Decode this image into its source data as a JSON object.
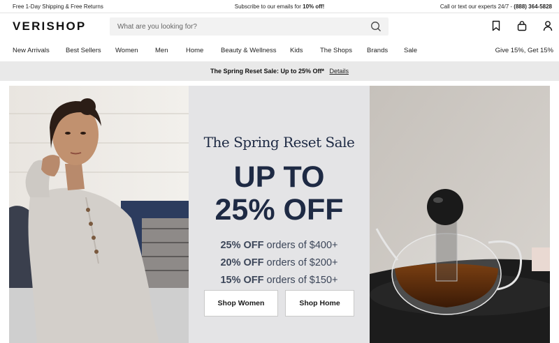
{
  "topbar": {
    "shipping": "Free 1-Day Shipping & Free Returns",
    "subscribe_prefix": "Subscribe to our emails for ",
    "subscribe_bold": "10% off!",
    "contact_prefix": "Call or text our experts 24/7 - ",
    "contact_phone": "(888) 364-5828"
  },
  "header": {
    "logo": "VERISHOP",
    "search_placeholder": "What are you looking for?",
    "icons": [
      "search-icon",
      "bookmark-icon",
      "bag-icon",
      "account-icon"
    ]
  },
  "nav": {
    "items": [
      "New Arrivals",
      "Best Sellers",
      "Women",
      "Men",
      "Home",
      "Beauty & Wellness",
      "Kids",
      "The Shops",
      "Brands",
      "Sale"
    ],
    "promo": "Give 15%, Get 15%"
  },
  "sale_banner": {
    "text": "The Spring Reset Sale: Up to 25% Off*",
    "link": "Details"
  },
  "hero": {
    "title": "The Spring Reset Sale",
    "headline_line1": "UP TO",
    "headline_line2": "25% OFF",
    "tiers": [
      {
        "bold": "25% OFF",
        "rest": " orders of $400+"
      },
      {
        "bold": "20% OFF",
        "rest": " orders of $200+"
      },
      {
        "bold": "15% OFF",
        "rest": " orders of $150+"
      }
    ],
    "button_women": "Shop Women",
    "button_home": "Shop Home"
  },
  "colors": {
    "navy": "#1e2a44",
    "banner_bg": "#e9e9e9",
    "center_panel": "#e4e4e6"
  }
}
